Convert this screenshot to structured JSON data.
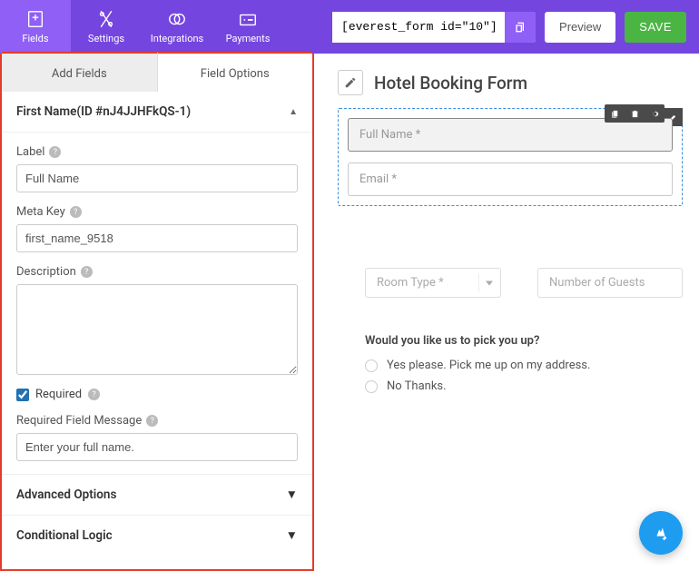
{
  "topnav": {
    "fields": "Fields",
    "settings": "Settings",
    "integrations": "Integrations",
    "payments": "Payments"
  },
  "shortcode": "[everest_form id=\"10\"]",
  "buttons": {
    "preview": "Preview",
    "save": "SAVE"
  },
  "leftTabs": {
    "add": "Add Fields",
    "options": "Field Options"
  },
  "accordion": {
    "title": "First Name(ID #nJ4JJHFkQS-1)",
    "advanced": "Advanced Options",
    "conditional": "Conditional Logic"
  },
  "labels": {
    "label": "Label",
    "metaKey": "Meta Key",
    "description": "Description",
    "required": "Required",
    "requiredMsg": "Required Field Message"
  },
  "values": {
    "label": "Full Name",
    "metaKey": "first_name_9518",
    "description": "",
    "requiredMsg": "Enter your full name."
  },
  "preview": {
    "formTitle": "Hotel Booking Form",
    "fullName": "Full Name *",
    "email": "Email *",
    "roomType": "Room Type *",
    "guests": "Number of Guests",
    "question": "Would you like us to pick you up?",
    "opt1": "Yes please. Pick me up on my address.",
    "opt2": "No Thanks."
  }
}
